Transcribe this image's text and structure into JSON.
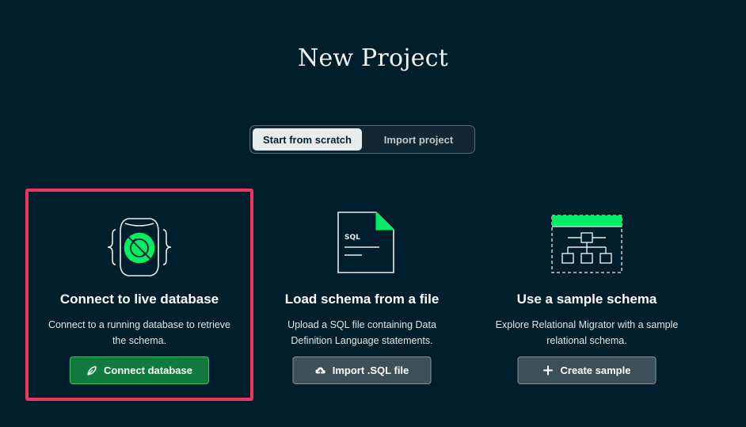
{
  "title": "New Project",
  "tabs": [
    {
      "label": "Start from scratch",
      "active": true
    },
    {
      "label": "Import project",
      "active": false
    }
  ],
  "cards": [
    {
      "title": "Connect to live database",
      "description_line1": "Connect to a running database to retrieve",
      "description_line2": "the schema.",
      "button_label": "Connect database",
      "button_icon": "leaf-icon",
      "illustration": "database-plug-icon"
    },
    {
      "title": "Load schema from a file",
      "description_line1": "Upload a SQL file containing Data",
      "description_line2": "Definition Language statements.",
      "button_label": "Import .SQL file",
      "button_icon": "cloud-upload-icon",
      "illustration": "sql-file-icon",
      "illustration_text": "SQL"
    },
    {
      "title": "Use a sample schema",
      "description_line1": "Explore Relational Migrator with a sample",
      "description_line2": "relational schema.",
      "button_label": "Create sample",
      "button_icon": "plus-icon",
      "illustration": "schema-diagram-icon"
    }
  ],
  "colors": {
    "background": "#001e2b",
    "accent_green": "#00ed64",
    "highlight_border": "#f0355f",
    "primary_button": "#137a3f"
  }
}
